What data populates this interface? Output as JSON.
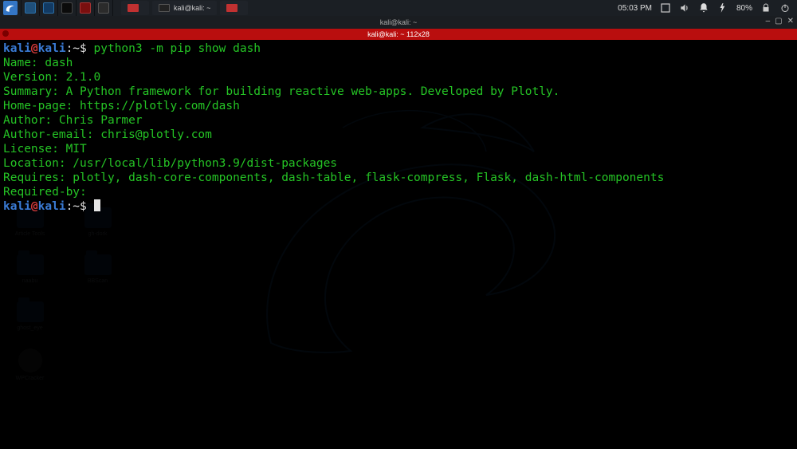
{
  "panel": {
    "tasks": [
      {
        "label": ""
      },
      {
        "label": "kali@kali: ~"
      },
      {
        "label": ""
      }
    ],
    "clock": "05:03 PM",
    "battery": "80%"
  },
  "desktop": {
    "icons": [
      [
        "Article Tools",
        "gh-dork"
      ],
      [
        "naabu",
        "BBScan"
      ],
      [
        "ghost_eye"
      ],
      [
        "WPCracker"
      ]
    ]
  },
  "terminal": {
    "title": "kali@kali: ~",
    "subtitle": "kali@kali: ~ 112x28",
    "prompt_user": "kali",
    "prompt_at": "@",
    "prompt_host": "kali",
    "prompt_path": ":~",
    "prompt_sym": "$",
    "command": "python3 -m pip show dash",
    "output": [
      "Name: dash",
      "Version: 2.1.0",
      "Summary: A Python framework for building reactive web-apps. Developed by Plotly.",
      "Home-page: https://plotly.com/dash",
      "Author: Chris Parmer",
      "Author-email: chris@plotly.com",
      "License: MIT",
      "Location: /usr/local/lib/python3.9/dist-packages",
      "Requires: plotly, dash-core-components, dash-table, flask-compress, Flask, dash-html-components",
      "Required-by: "
    ]
  }
}
